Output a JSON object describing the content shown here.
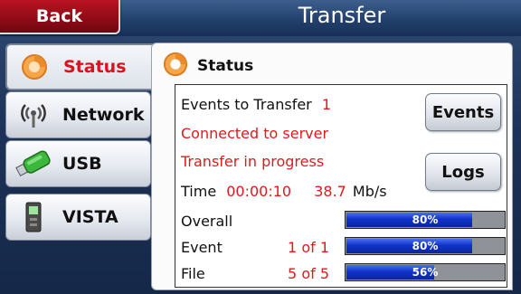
{
  "header": {
    "title": "Transfer",
    "back_label": "Back"
  },
  "sidebar": {
    "items": [
      {
        "label": "Status",
        "active": true,
        "icon": "status-ring-icon"
      },
      {
        "label": "Network",
        "active": false,
        "icon": "antenna-icon"
      },
      {
        "label": "USB",
        "active": false,
        "icon": "usb-drive-icon"
      },
      {
        "label": "VISTA",
        "active": false,
        "icon": "vista-device-icon"
      }
    ]
  },
  "panel": {
    "title": "Status",
    "events_label": "Events to Transfer",
    "events_count": "1",
    "status_line1": "Connected to server",
    "status_line2": "Transfer in progress",
    "time_label": "Time",
    "time_value": "00:00:10",
    "rate_value": "38.7",
    "rate_unit": "Mb/s",
    "buttons": {
      "events": "Events",
      "logs": "Logs"
    },
    "progress": [
      {
        "label": "Overall",
        "count": "",
        "percent": 80,
        "percent_text": "80%"
      },
      {
        "label": "Event",
        "count": "1 of 1",
        "percent": 80,
        "percent_text": "80%"
      },
      {
        "label": "File",
        "count": "5 of 5",
        "percent": 56,
        "percent_text": "56%"
      }
    ]
  },
  "colors": {
    "accent_red": "#e01a1a",
    "back_red": "#a30e1c",
    "progress_blue": "#1133cc"
  }
}
